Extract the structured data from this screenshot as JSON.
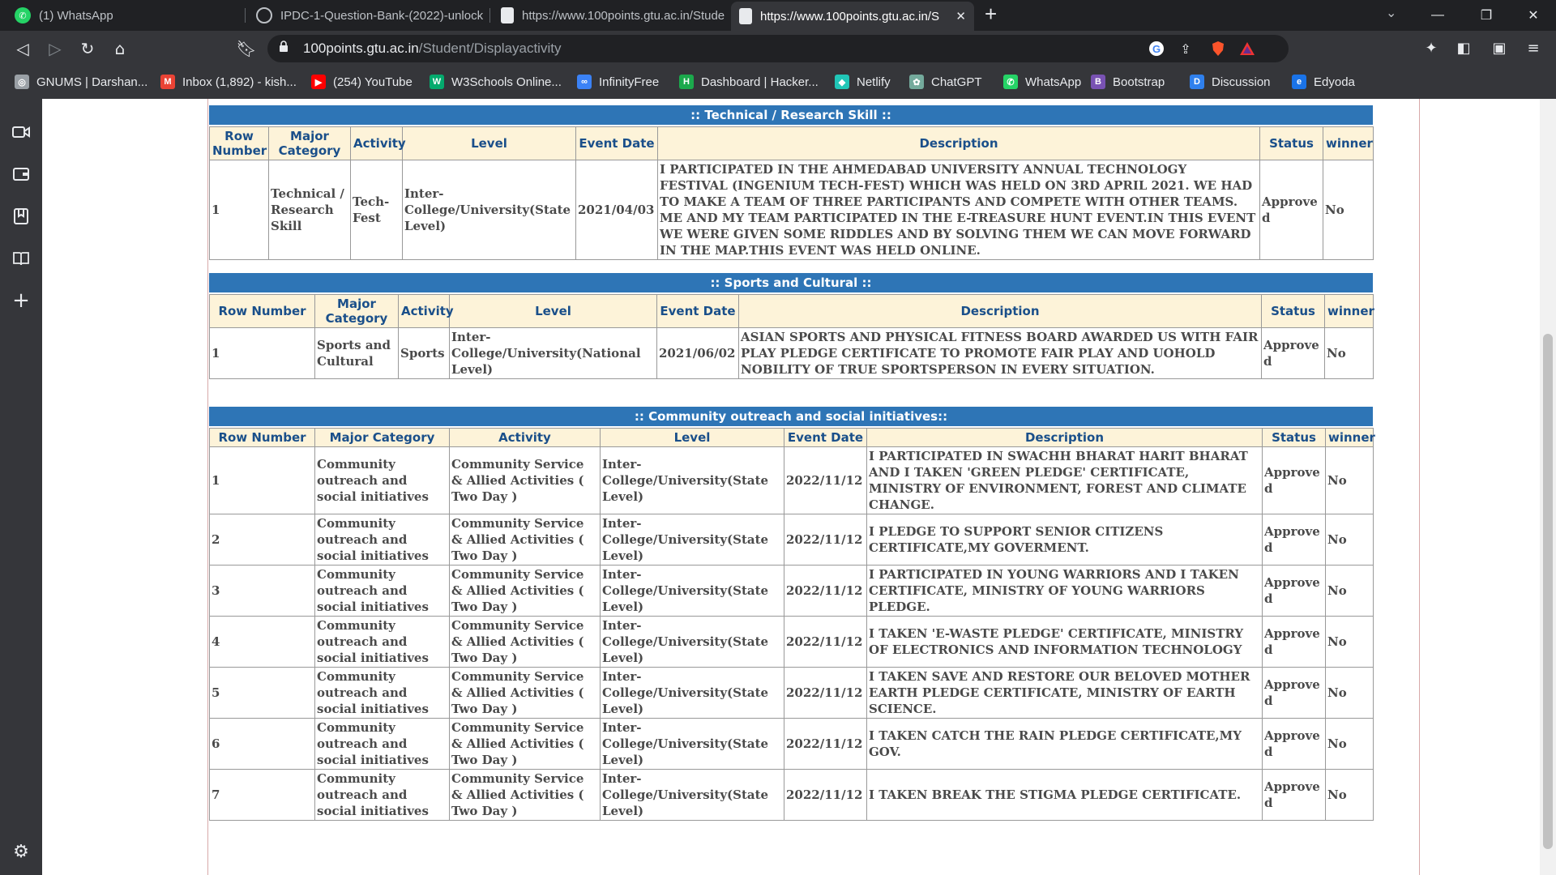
{
  "browser": {
    "tabs": [
      {
        "title": "(1) WhatsApp",
        "active": false
      },
      {
        "title": "IPDC-1-Question-Bank-(2022)-unlock",
        "active": false
      },
      {
        "title": "https://www.100points.gtu.ac.in/Stude",
        "active": false
      },
      {
        "title": "https://www.100points.gtu.ac.in/S",
        "active": true
      }
    ],
    "url_host": "100points.gtu.ac.in",
    "url_path": "/Student/Displayactivity",
    "bookmarks": [
      {
        "label": "GNUMS | Darshan...",
        "icon": "globe-icon",
        "color": "#9aa0a6"
      },
      {
        "label": "Inbox (1,892) - kish...",
        "icon": "gmail-icon",
        "color": "#ea4335"
      },
      {
        "label": "(254) YouTube",
        "icon": "youtube-icon",
        "color": "#ff0000"
      },
      {
        "label": "W3Schools Online...",
        "icon": "w3schools-icon",
        "color": "#04aa6d"
      },
      {
        "label": "InfinityFree",
        "icon": "infinityfree-icon",
        "color": "#3b82f6"
      },
      {
        "label": "Dashboard | Hacker...",
        "icon": "hackerrank-icon",
        "color": "#1ba94c"
      },
      {
        "label": "Netlify",
        "icon": "netlify-icon",
        "color": "#20c6b7"
      },
      {
        "label": "ChatGPT",
        "icon": "chatgpt-icon",
        "color": "#74aa9c"
      },
      {
        "label": "WhatsApp",
        "icon": "whatsapp-icon",
        "color": "#25d366"
      },
      {
        "label": "Bootstrap",
        "icon": "bootstrap-icon",
        "color": "#7952b3"
      },
      {
        "label": "Discussion",
        "icon": "discussion-icon",
        "color": "#2f80ed"
      },
      {
        "label": "Edyoda",
        "icon": "edyoda-icon",
        "color": "#1a73e8"
      }
    ]
  },
  "sections": {
    "technical": {
      "title": ":: Technical / Research Skill ::",
      "headers": [
        "Row Number",
        "Major Category",
        "Activity",
        "Level",
        "Event Date",
        "Description",
        "Status",
        "winner"
      ],
      "rows": [
        [
          "1",
          "Technical / Research Skill",
          "Tech-Fest",
          "Inter-College/University(State Level)",
          "2021/04/03",
          "I PARTICIPATED IN THE AHMEDABAD UNIVERSITY ANNUAL TECHNOLOGY FESTIVAL (INGENIUM TECH-FEST) WHICH WAS HELD ON 3RD APRIL 2021. WE HAD TO MAKE A TEAM OF THREE PARTICIPANTS AND COMPETE WITH OTHER TEAMS. ME AND MY TEAM PARTICIPATED IN THE E-TREASURE HUNT EVENT.IN THIS EVENT WE WERE GIVEN SOME RIDDLES AND BY SOLVING THEM WE CAN MOVE FORWARD IN THE MAP.THIS EVENT WAS HELD ONLINE.",
          "Approved",
          "No"
        ]
      ]
    },
    "sports": {
      "title": ":: Sports and Cultural ::",
      "headers": [
        "Row Number",
        "Major Category",
        "Activity",
        "Level",
        "Event Date",
        "Description",
        "Status",
        "winner"
      ],
      "rows": [
        [
          "1",
          "Sports and Cultural",
          "Sports",
          "Inter-College/University(National Level)",
          "2021/06/02",
          "ASIAN SPORTS AND PHYSICAL FITNESS BOARD AWARDED US WITH FAIR PLAY PLEDGE CERTIFICATE TO PROMOTE FAIR PLAY AND UOHOLD NOBILITY OF TRUE SPORTSPERSON IN EVERY SITUATION.",
          "Approved",
          "No"
        ]
      ]
    },
    "community": {
      "title": ":: Community outreach and social initiatives::",
      "headers": [
        "Row Number",
        "Major Category",
        "Activity",
        "Level",
        "Event Date",
        "Description",
        "Status",
        "winner"
      ],
      "rows": [
        [
          "1",
          "Community outreach and social initiatives",
          "Community Service & Allied Activities ( Two Day )",
          "Inter-College/University(State Level)",
          "2022/11/12",
          "I PARTICIPATED IN SWACHH BHARAT HARIT BHARAT AND I TAKEN 'GREEN PLEDGE' CERTIFICATE, MINISTRY OF ENVIRONMENT, FOREST AND CLIMATE CHANGE.",
          "Approved",
          "No"
        ],
        [
          "2",
          "Community outreach and social initiatives",
          "Community Service & Allied Activities ( Two Day )",
          "Inter-College/University(State Level)",
          "2022/11/12",
          "I PLEDGE TO SUPPORT SENIOR CITIZENS CERTIFICATE,MY GOVERMENT.",
          "Approved",
          "No"
        ],
        [
          "3",
          "Community outreach and social initiatives",
          "Community Service & Allied Activities ( Two Day )",
          "Inter-College/University(State Level)",
          "2022/11/12",
          "I PARTICIPATED IN YOUNG WARRIORS AND I TAKEN CERTIFICATE, MINISTRY OF YOUNG WARRIORS PLEDGE.",
          "Approved",
          "No"
        ],
        [
          "4",
          "Community outreach and social initiatives",
          "Community Service & Allied Activities ( Two Day )",
          "Inter-College/University(State Level)",
          "2022/11/12",
          "I TAKEN 'E-WASTE PLEDGE' CERTIFICATE, MINISTRY OF ELECTRONICS AND INFORMATION TECHNOLOGY",
          "Approved",
          "No"
        ],
        [
          "5",
          "Community outreach and social initiatives",
          "Community Service & Allied Activities ( Two Day )",
          "Inter-College/University(State Level)",
          "2022/11/12",
          "I TAKEN SAVE AND RESTORE OUR BELOVED MOTHER EARTH PLEDGE CERTIFICATE, MINISTRY OF EARTH SCIENCE.",
          "Approved",
          "No"
        ],
        [
          "6",
          "Community outreach and social initiatives",
          "Community Service & Allied Activities ( Two Day )",
          "Inter-College/University(State Level)",
          "2022/11/12",
          "I TAKEN CATCH THE RAIN PLEDGE CERTIFICATE,MY GOV.",
          "Approved",
          "No"
        ],
        [
          "7",
          "Community outreach and social initiatives",
          "Community Service & Allied Activities ( Two Day )",
          "Inter-College/University(State Level)",
          "2022/11/12",
          "I TAKEN BREAK THE STIGMA PLEDGE CERTIFICATE.",
          "Approved",
          "No"
        ]
      ]
    }
  }
}
